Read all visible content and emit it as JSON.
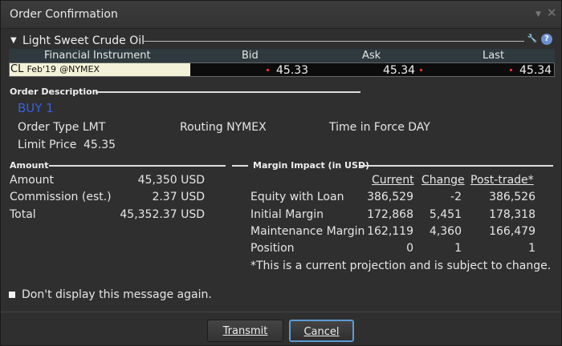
{
  "window": {
    "title": "Order Confirmation"
  },
  "instrument_section": {
    "title": "Light Sweet Crude Oil",
    "headers": {
      "instrument": "Financial Instrument",
      "bid": "Bid",
      "ask": "Ask",
      "last": "Last"
    },
    "row": {
      "symbol": "CL",
      "contract": "Feb'19",
      "exchange": "@NYMEX",
      "bid": "45.33",
      "ask": "45.34",
      "last": "45.34"
    }
  },
  "order_description": {
    "heading": "Order Description",
    "action": "BUY 1",
    "order_type": "Order Type LMT",
    "routing": "Routing NYMEX",
    "time_in_force": "Time in Force DAY",
    "limit_price_label": "Limit Price",
    "limit_price": "45.35"
  },
  "amount": {
    "heading": "Amount",
    "rows": [
      {
        "label": "Amount",
        "value": "45,350 USD"
      },
      {
        "label": "Commission (est.)",
        "value": "2.37 USD"
      },
      {
        "label": "Total",
        "value": "45,352.37 USD"
      }
    ]
  },
  "margin": {
    "heading": "Margin Impact (in USD)",
    "columns": {
      "current": "Current",
      "change": "Change",
      "post": "Post-trade*"
    },
    "rows": [
      {
        "label": "Equity with Loan",
        "current": "386,529",
        "change": "-2",
        "post": "386,526"
      },
      {
        "label": "Initial Margin",
        "current": "172,868",
        "change": "5,451",
        "post": "178,318"
      },
      {
        "label": "Maintenance Margin",
        "current": "162,119",
        "change": "4,360",
        "post": "166,479"
      },
      {
        "label": "Position",
        "current": "0",
        "change": "1",
        "post": "1"
      }
    ],
    "note": "*This is a current projection and is subject to change."
  },
  "dont_display": "Don't display this message again.",
  "buttons": {
    "transmit": "Transmit",
    "cancel": "Cancel"
  }
}
